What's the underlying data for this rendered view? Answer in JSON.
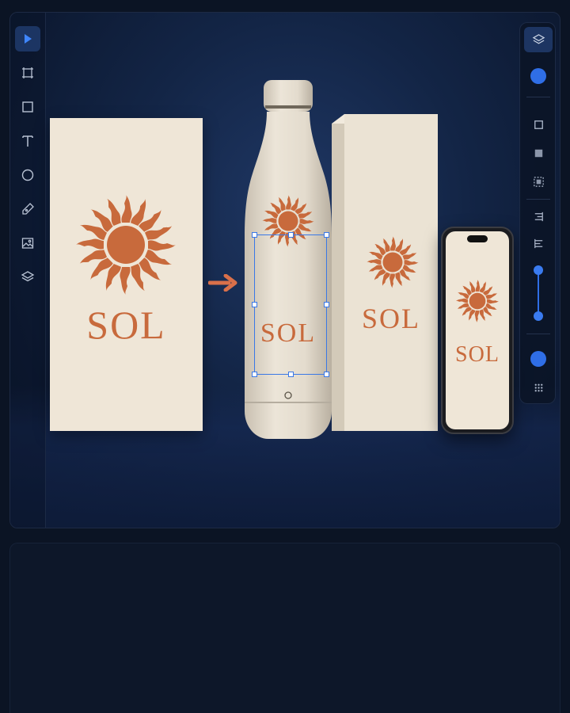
{
  "toolbar_left": {
    "tools": [
      {
        "name": "select-tool",
        "icon": "pointer-icon",
        "active": true
      },
      {
        "name": "frame-tool",
        "icon": "frame-icon"
      },
      {
        "name": "rectangle-tool",
        "icon": "square-icon"
      },
      {
        "name": "text-tool",
        "icon": "text-icon"
      },
      {
        "name": "ellipse-tool",
        "icon": "circle-icon"
      },
      {
        "name": "pen-tool",
        "icon": "pen-icon"
      },
      {
        "name": "image-tool",
        "icon": "image-icon"
      },
      {
        "name": "layers-tool",
        "icon": "layers-icon"
      }
    ]
  },
  "toolbar_right": {
    "items": [
      "layers-icon",
      "color-dot",
      "fill-square-icon",
      "solid-square-icon",
      "dashed-square-icon",
      "align-right-icon",
      "align-left-icon",
      "opacity-slider",
      "color-dot",
      "grid-dots-icon"
    ],
    "accent_color": "#2f6ee6"
  },
  "artwork": {
    "brand_text": "SOL",
    "sun_color": "#c86a3c",
    "card_color": "#efe6d7"
  },
  "mockups": {
    "bottle_label": "SOL",
    "box_label": "SOL",
    "phone_label": "SOL"
  },
  "colors": {
    "background": "#0b1424",
    "selection": "#3a78e6",
    "arrow": "#d9704a"
  }
}
